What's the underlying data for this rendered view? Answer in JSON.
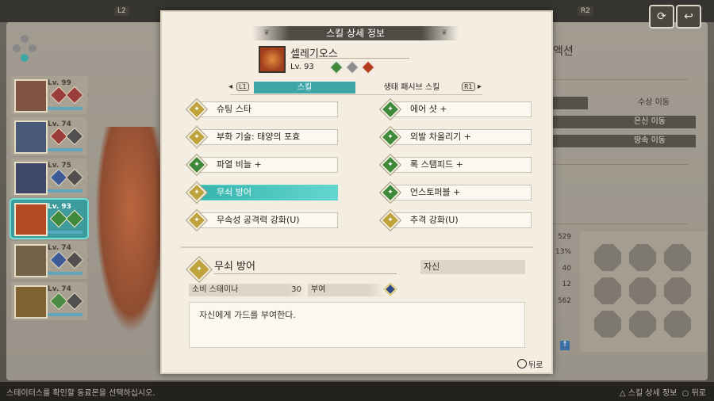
{
  "topbar": {
    "l2": "L2",
    "r2": "R2"
  },
  "background": {
    "right_title": "액션",
    "moves": [
      "수상 이동",
      "은신 이동",
      "땅속 이동"
    ],
    "stats": [
      "529",
      "13%",
      "40",
      "12",
      "562"
    ],
    "party_levels": [
      "Lv. 99",
      "Lv. 74",
      "Lv. 75",
      "Lv. 93",
      "Lv. 74",
      "Lv. 74"
    ]
  },
  "modal": {
    "title": "스킬 상세 정보",
    "monster_name": "셀레기오스",
    "monster_level": "Lv. 93",
    "tabs": {
      "left_key": "L1",
      "right_key": "R1",
      "active": "스킬",
      "inactive": "생태 패시브 스킬"
    },
    "skills_left": [
      "슈팅 스타",
      "부화 기술: 태양의 포효",
      "파열 비늘 +",
      "무쇠 방어",
      "무속성 공격력 강화(U)"
    ],
    "skills_right": [
      "에어 샷 +",
      "외발 차올리기 +",
      "록 스탬피드 +",
      "언스토퍼블 +",
      "추격 강화(U)"
    ],
    "selected": {
      "name": "무쇠 방어",
      "target": "자신",
      "cost_label": "소비 스태미나",
      "cost_value": "30",
      "grant_label": "부여",
      "description": "자신에게 가드를 부여한다."
    },
    "back_label": "뒤로"
  },
  "bottombar": {
    "hint": "스테이터스를 확인할 동료몬을 선택하십시오.",
    "right_hint_1": "스킬 상세 정보",
    "right_hint_2": "뒤로"
  },
  "colors": {
    "accent": "#3fa6a8",
    "selected_row": "#4cc5be",
    "gold_skill": "#bfa33c",
    "green_skill": "#3e8a3a"
  }
}
